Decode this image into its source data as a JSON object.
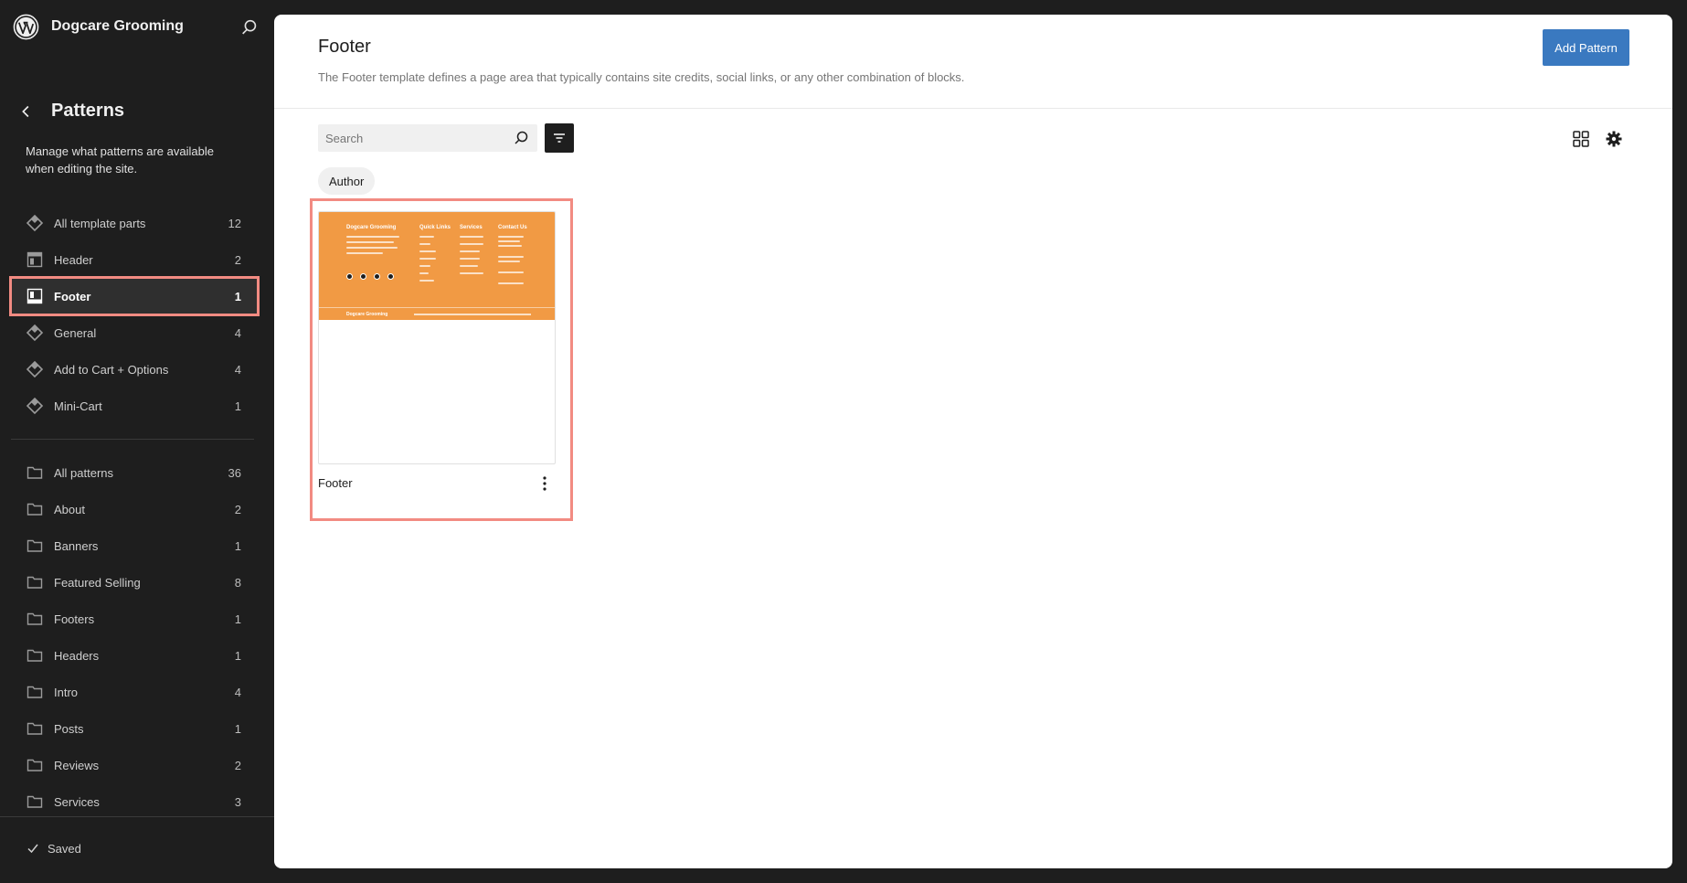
{
  "site": {
    "title": "Dogcare Grooming"
  },
  "nav": {
    "title": "Patterns",
    "description": "Manage what patterns are available when editing the site.",
    "template_parts": [
      {
        "label": "All template parts",
        "count": "12",
        "icon": "symbol-icon"
      },
      {
        "label": "Header",
        "count": "2",
        "icon": "header-icon"
      },
      {
        "label": "Footer",
        "count": "1",
        "icon": "footer-icon"
      },
      {
        "label": "General",
        "count": "4",
        "icon": "symbol-icon"
      },
      {
        "label": "Add to Cart + Options",
        "count": "4",
        "icon": "symbol-icon"
      },
      {
        "label": "Mini-Cart",
        "count": "1",
        "icon": "symbol-icon"
      }
    ],
    "patterns": [
      {
        "label": "All patterns",
        "count": "36"
      },
      {
        "label": "About",
        "count": "2"
      },
      {
        "label": "Banners",
        "count": "1"
      },
      {
        "label": "Featured Selling",
        "count": "8"
      },
      {
        "label": "Footers",
        "count": "1"
      },
      {
        "label": "Headers",
        "count": "1"
      },
      {
        "label": "Intro",
        "count": "4"
      },
      {
        "label": "Posts",
        "count": "1"
      },
      {
        "label": "Reviews",
        "count": "2"
      },
      {
        "label": "Services",
        "count": "3"
      }
    ],
    "status": "Saved"
  },
  "main": {
    "title": "Footer",
    "description": "The Footer template defines a page area that typically contains site credits, social links, or any other combination of blocks.",
    "add_button": "Add Pattern",
    "search_placeholder": "Search",
    "author_filter": "Author",
    "card": {
      "title": "Footer",
      "preview": {
        "brand": "Dogcare Grooming",
        "col_quick": "Quick Links",
        "col_services": "Services",
        "col_contact": "Contact Us",
        "bottom_brand": "Dogcare Grooming"
      }
    }
  },
  "colors": {
    "accent": "#3a79c0",
    "highlight": "#f28b82",
    "preview_bg": "#f19a44",
    "sidebar_bg": "#1e1e1e"
  }
}
